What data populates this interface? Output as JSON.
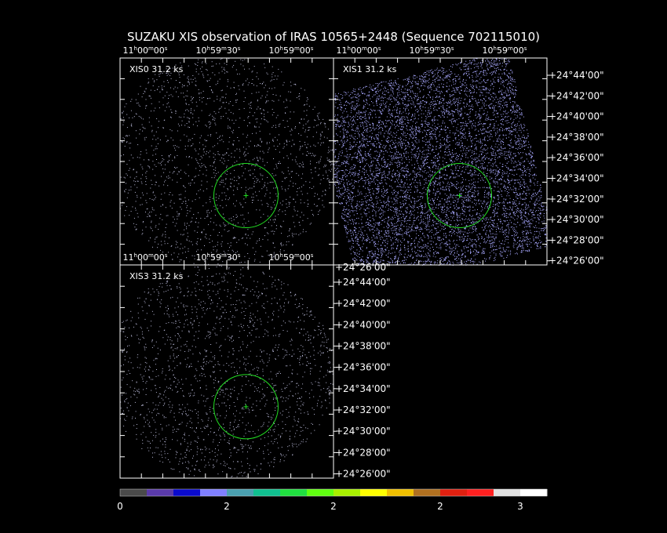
{
  "title": "SUZAKU XIS observation of IRAS 10565+2448  (Sequence 702115010)",
  "panels": [
    {
      "label": "XIS0 31.2 ks",
      "density": 1900,
      "dot_color": "#b8b8d8"
    },
    {
      "label": "XIS1 31.2 ks",
      "density": 9000,
      "dot_color": "#a8a8ff"
    },
    {
      "label": "XIS3 31.2 ks",
      "density": 1900,
      "dot_color": "#b8b8d8"
    }
  ],
  "ra_ticks": [
    {
      "h": "11",
      "hu": "h",
      "m": "00",
      "mu": "m",
      "s": "00",
      "su": "s"
    },
    {
      "h": "10",
      "hu": "h",
      "m": "59",
      "mu": "m",
      "s": "30",
      "su": "s"
    },
    {
      "h": "10",
      "hu": "h",
      "m": "59",
      "mu": "m",
      "s": "00",
      "su": "s"
    }
  ],
  "dec_ticks": [
    "+24°44'00\"",
    "+24°42'00\"",
    "+24°40'00\"",
    "+24°38'00\"",
    "+24°36'00\"",
    "+24°34'00\"",
    "+24°32'00\"",
    "+24°30'00\"",
    "+24°28'00\"",
    "+24°26'00\""
  ],
  "dec_overlap_label": "+24°26'00\"",
  "colorbar": {
    "colors": [
      "#4a4a4a",
      "#5a3aaa",
      "#0a0acc",
      "#8080ff",
      "#4aa0b0",
      "#10c090",
      "#20e040",
      "#60ff10",
      "#a8f000",
      "#ffff00",
      "#f0c000",
      "#b07020",
      "#e02010",
      "#ff2020",
      "#e0e0e0",
      "#ffffff"
    ],
    "ticks": [
      "0",
      "2",
      "2",
      "2",
      "3"
    ]
  },
  "colors": {
    "background": "#000000",
    "axes": "#ffffff",
    "region": "#22dd22"
  }
}
